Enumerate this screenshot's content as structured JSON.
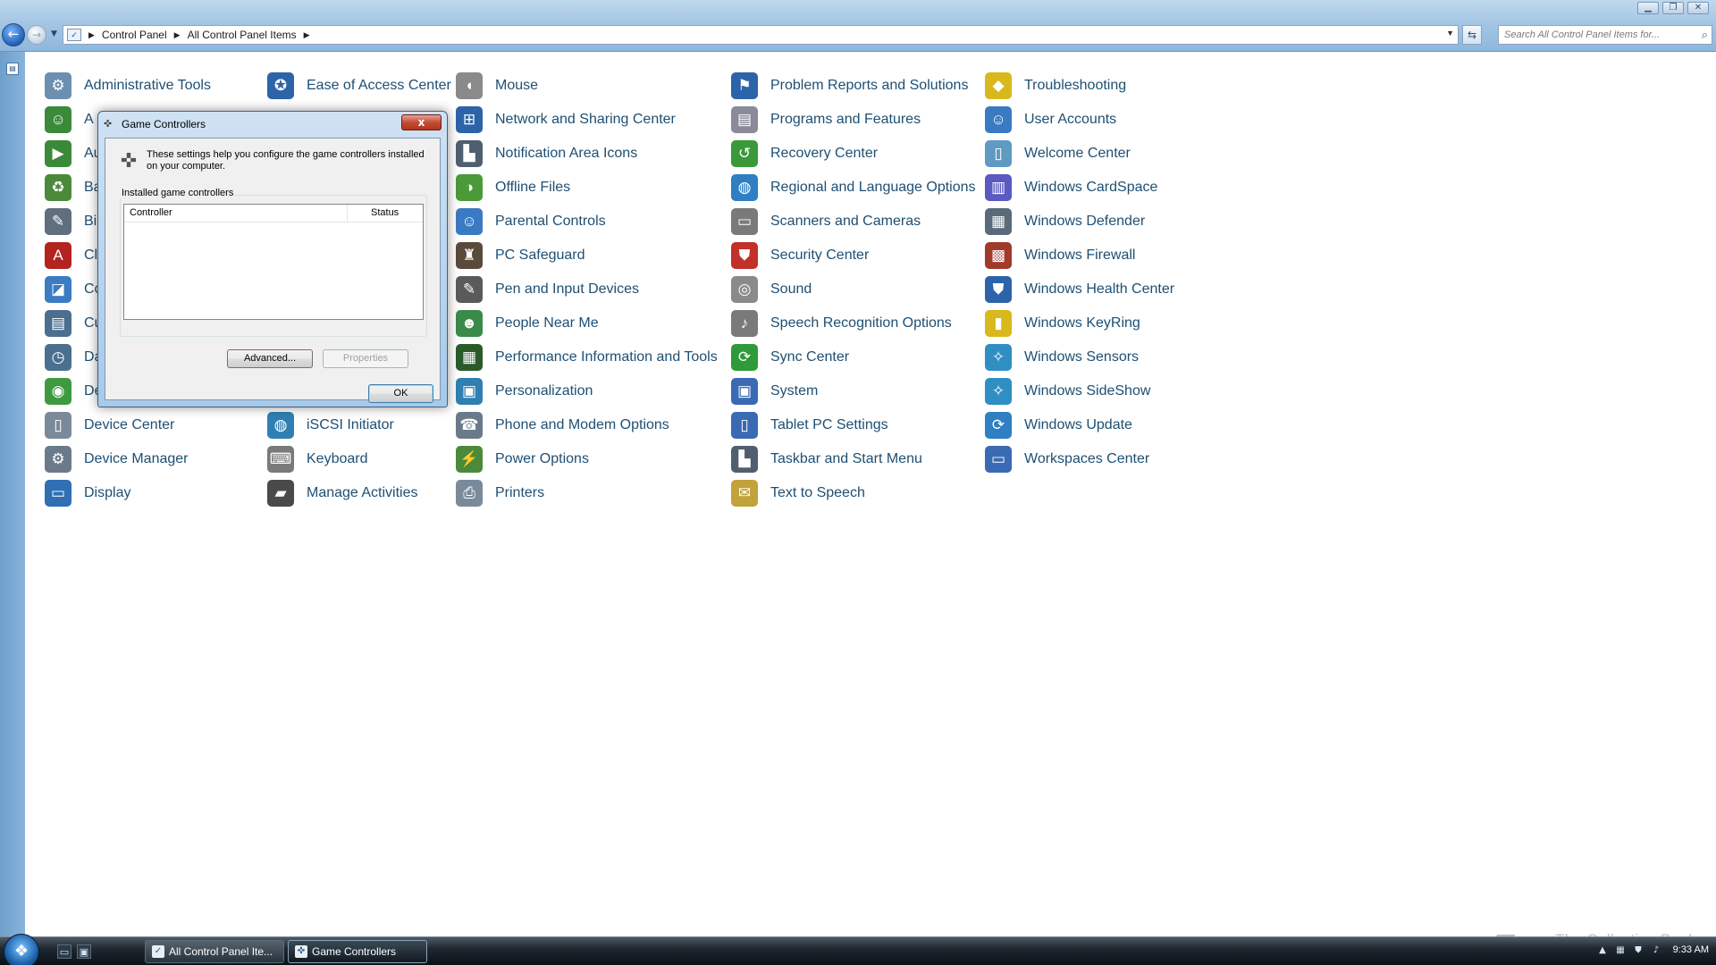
{
  "window": {
    "minimize": "▁",
    "maximize": "❐",
    "close": "✕"
  },
  "address": {
    "crumbs": [
      "Control Panel",
      "All Control Panel Items"
    ],
    "search_placeholder": "Search All Control Panel Items for..."
  },
  "items": [
    {
      "label": "Administrative Tools",
      "icon": "admin-tools-icon",
      "glyph": "⚙",
      "color": "#6c8fb0"
    },
    {
      "label": "A",
      "icon": "autoplay-icon",
      "glyph": "☺",
      "color": "#3a8a3a"
    },
    {
      "label": "Au",
      "icon": "autoplay-icon",
      "glyph": "▶",
      "color": "#3a8a3a"
    },
    {
      "label": "Ba",
      "icon": "backup-icon",
      "glyph": "♻",
      "color": "#4a8a3a"
    },
    {
      "label": "Bi",
      "icon": "biometric-icon",
      "glyph": "✎",
      "color": "#5f6f7f"
    },
    {
      "label": "Cl",
      "icon": "color-management-icon",
      "glyph": "A",
      "color": "#b3241f"
    },
    {
      "label": "Co",
      "icon": "color-icon",
      "glyph": "◪",
      "color": "#3b7cc2"
    },
    {
      "label": "Cu",
      "icon": "customize-icon",
      "glyph": "▤",
      "color": "#4c6f8f"
    },
    {
      "label": "Da",
      "icon": "date-time-icon",
      "glyph": "◷",
      "color": "#4c6f8f"
    },
    {
      "label": "De",
      "icon": "default-programs-icon",
      "glyph": "◉",
      "color": "#3f9a3f"
    },
    {
      "label": "Device Center",
      "icon": "device-center-icon",
      "glyph": "▯",
      "color": "#7a8a9a"
    },
    {
      "label": "Device Manager",
      "icon": "device-manager-icon",
      "glyph": "⚙",
      "color": "#6a7a8a"
    },
    {
      "label": "Display",
      "icon": "display-icon",
      "glyph": "▭",
      "color": "#2f6fb3"
    },
    {
      "label": "Ease of Access Center",
      "icon": "ease-of-access-icon",
      "glyph": "✪",
      "color": "#2d63a8"
    },
    {
      "label": "iSCSI Initiator",
      "icon": "iscsi-icon",
      "glyph": "◍",
      "color": "#2f7fb3"
    },
    {
      "label": "Keyboard",
      "icon": "keyboard-icon",
      "glyph": "⌨",
      "color": "#7a7a7a"
    },
    {
      "label": "Manage Activities",
      "icon": "manage-activities-icon",
      "glyph": "▰",
      "color": "#4a4a4a"
    },
    {
      "label": "Mouse",
      "icon": "mouse-icon",
      "glyph": "◖",
      "color": "#8a8a8a"
    },
    {
      "label": "Network and Sharing Center",
      "icon": "network-icon",
      "glyph": "⊞",
      "color": "#2d63a8"
    },
    {
      "label": "Notification Area Icons",
      "icon": "notification-icon",
      "glyph": "▙",
      "color": "#4f5f6f"
    },
    {
      "label": "Offline Files",
      "icon": "offline-files-icon",
      "glyph": "◑",
      "color": "#4a9a3a"
    },
    {
      "label": "Parental Controls",
      "icon": "parental-controls-icon",
      "glyph": "☺",
      "color": "#3a7ac2"
    },
    {
      "label": "PC Safeguard",
      "icon": "pc-safeguard-icon",
      "glyph": "♜",
      "color": "#5a4a3a"
    },
    {
      "label": "Pen and Input Devices",
      "icon": "pen-icon",
      "glyph": "✎",
      "color": "#5a5a5a"
    },
    {
      "label": "People Near Me",
      "icon": "people-near-me-icon",
      "glyph": "☻",
      "color": "#3a8a4a"
    },
    {
      "label": "Performance Information and Tools",
      "icon": "performance-icon",
      "glyph": "▦",
      "color": "#2a5a2a"
    },
    {
      "label": "Personalization",
      "icon": "personalization-icon",
      "glyph": "▣",
      "color": "#2f7fb3"
    },
    {
      "label": "Phone and Modem Options",
      "icon": "phone-modem-icon",
      "glyph": "☎",
      "color": "#6a7a8a"
    },
    {
      "label": "Power Options",
      "icon": "power-options-icon",
      "glyph": "⚡",
      "color": "#4a8a3a"
    },
    {
      "label": "Printers",
      "icon": "printers-icon",
      "glyph": "⎙",
      "color": "#7a8a9a"
    },
    {
      "label": "Problem Reports and Solutions",
      "icon": "problem-reports-icon",
      "glyph": "⚑",
      "color": "#2d63a8"
    },
    {
      "label": "Programs and Features",
      "icon": "programs-features-icon",
      "glyph": "▤",
      "color": "#8a8a9a"
    },
    {
      "label": "Recovery Center",
      "icon": "recovery-icon",
      "glyph": "↺",
      "color": "#3a9a3a"
    },
    {
      "label": "Regional and Language Options",
      "icon": "regional-icon",
      "glyph": "◍",
      "color": "#2f7fc2"
    },
    {
      "label": "Scanners and Cameras",
      "icon": "scanners-icon",
      "glyph": "▭",
      "color": "#7a7a7a"
    },
    {
      "label": "Security Center",
      "icon": "security-center-icon",
      "glyph": "⛊",
      "color": "#c2302a"
    },
    {
      "label": "Sound",
      "icon": "sound-icon",
      "glyph": "◎",
      "color": "#8a8a8a"
    },
    {
      "label": "Speech Recognition Options",
      "icon": "speech-recognition-icon",
      "glyph": "♪",
      "color": "#7a7a7a"
    },
    {
      "label": "Sync Center",
      "icon": "sync-center-icon",
      "glyph": "⟳",
      "color": "#2f9a3a"
    },
    {
      "label": "System",
      "icon": "system-icon",
      "glyph": "▣",
      "color": "#3a6ab3"
    },
    {
      "label": "Tablet PC Settings",
      "icon": "tablet-pc-icon",
      "glyph": "▯",
      "color": "#3a6ab3"
    },
    {
      "label": "Taskbar and Start Menu",
      "icon": "taskbar-start-icon",
      "glyph": "▙",
      "color": "#4f5f6f"
    },
    {
      "label": "Text to Speech",
      "icon": "text-to-speech-icon",
      "glyph": "✉",
      "color": "#c2a23a"
    },
    {
      "label": "Troubleshooting",
      "icon": "troubleshooting-icon",
      "glyph": "◆",
      "color": "#d8b81a"
    },
    {
      "label": "User Accounts",
      "icon": "user-accounts-icon",
      "glyph": "☺",
      "color": "#3a7ac2"
    },
    {
      "label": "Welcome Center",
      "icon": "welcome-center-icon",
      "glyph": "▯",
      "color": "#5f9ac2"
    },
    {
      "label": "Windows CardSpace",
      "icon": "cardspace-icon",
      "glyph": "▥",
      "color": "#5a5ac2"
    },
    {
      "label": "Windows Defender",
      "icon": "defender-icon",
      "glyph": "▦",
      "color": "#5a6a7a"
    },
    {
      "label": "Windows Firewall",
      "icon": "firewall-icon",
      "glyph": "▩",
      "color": "#a23a2a"
    },
    {
      "label": "Windows Health Center",
      "icon": "health-center-icon",
      "glyph": "⛊",
      "color": "#2d63a8"
    },
    {
      "label": "Windows KeyRing",
      "icon": "keyring-icon",
      "glyph": "▮",
      "color": "#d8b81a"
    },
    {
      "label": "Windows Sensors",
      "icon": "sensors-icon",
      "glyph": "✧",
      "color": "#2f8fc2"
    },
    {
      "label": "Windows SideShow",
      "icon": "sideshow-icon",
      "glyph": "✧",
      "color": "#2f8fc2"
    },
    {
      "label": "Windows Update",
      "icon": "windows-update-icon",
      "glyph": "⟳",
      "color": "#2f7fc2"
    },
    {
      "label": "Workspaces Center",
      "icon": "workspaces-icon",
      "glyph": "▭",
      "color": "#3a6ab3"
    }
  ],
  "dialog": {
    "title": "Game Controllers",
    "close": "x",
    "description": "These settings help you configure the game controllers installed on your computer.",
    "group_label": "Installed game controllers",
    "columns": [
      "Controller",
      "Status"
    ],
    "advanced_button": "Advanced...",
    "properties_button": "Properties",
    "ok_button": "OK"
  },
  "taskbar": {
    "tasks": [
      {
        "label": "All Control Panel Ite...",
        "active": false
      },
      {
        "label": "Game Controllers",
        "active": true
      }
    ],
    "clock": "9:33 AM"
  },
  "watermark": "The Collection Book"
}
